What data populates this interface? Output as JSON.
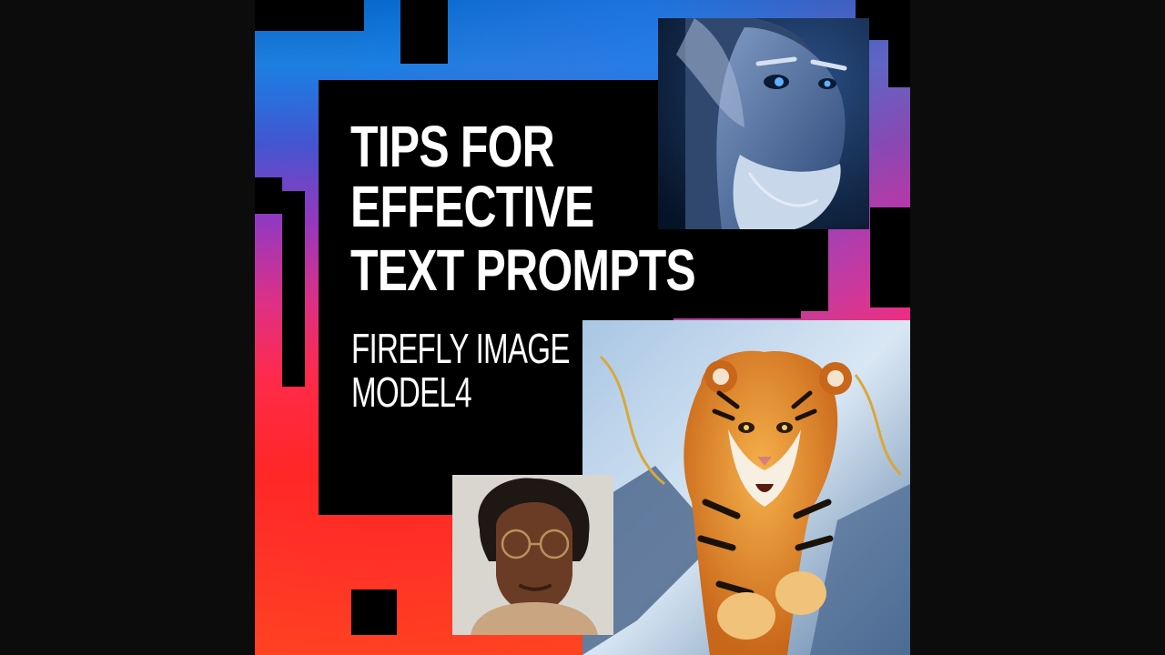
{
  "poster": {
    "title_lines": [
      "TIPS FOR",
      "EFFECTIVE",
      "TEXT PROMPTS"
    ],
    "subtitle_lines": [
      "FIREFLY IMAGE",
      "MODEL4"
    ]
  },
  "images": [
    {
      "subject": "elderly-man-portrait-icon"
    },
    {
      "subject": "leaping-tiger-icon"
    },
    {
      "subject": "man-with-glasses-portrait-icon"
    }
  ],
  "colors": {
    "background": "#0c0c0c",
    "panel": "#000000",
    "gradient_top": "#0a67c9",
    "gradient_mid": "#d6339a",
    "gradient_bottom": "#ff2a2a",
    "text": "#ffffff"
  }
}
